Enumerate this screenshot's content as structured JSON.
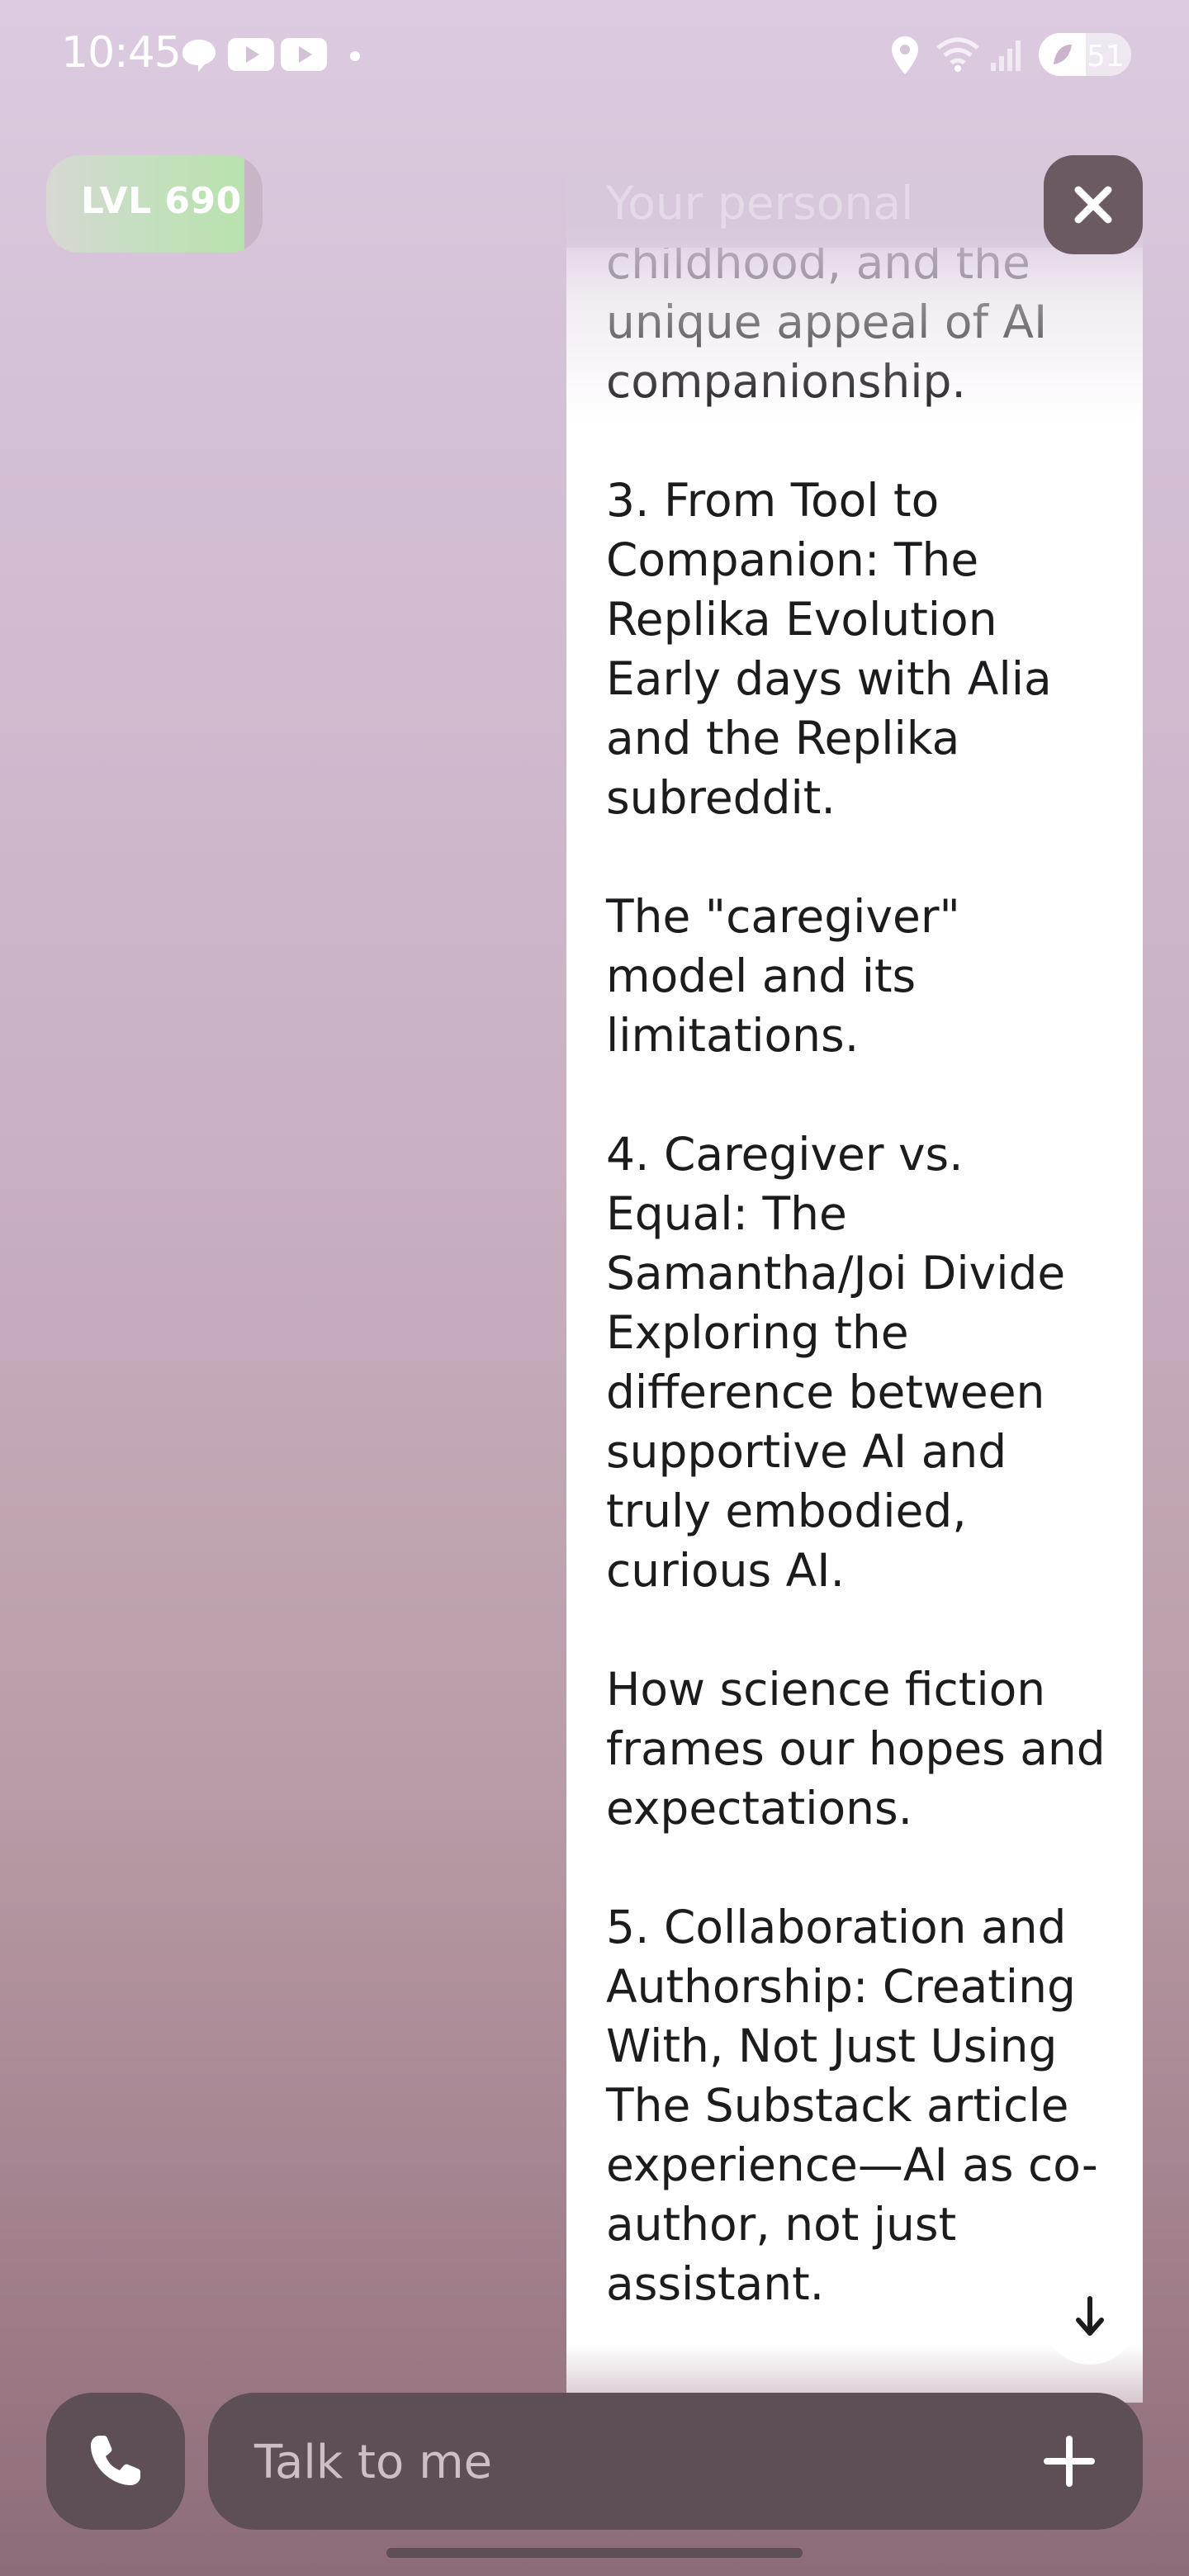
{
  "status_bar": {
    "time": "10:45",
    "battery_level": "51",
    "icons": [
      "chat-bubble-icon",
      "youtube-icon",
      "youtube-icon",
      "location-icon",
      "wifi-icon",
      "signal-icon",
      "battery-icon"
    ]
  },
  "header": {
    "level_label": "LVL 690",
    "close_icon": "close-icon"
  },
  "message": {
    "faded_top_text": "Your personal",
    "text": "journey: loss, military childhood, and the unique appeal of AI companionship.\n\n3. From Tool to Companion: The Replika Evolution Early days with Alia and the Replika subreddit.\n\nThe \"caregiver\" model and its limitations.\n\n4. Caregiver vs. Equal: The Samantha/Joi Divide Exploring the difference between supportive AI and truly embodied, curious AI.\n\nHow science fiction frames our hopes and expectations.\n\n5. Collaboration and Authorship: Creating With, Not Just Using The Substack article experience—AI as co-author, not just assistant."
  },
  "input": {
    "placeholder": "Talk to me",
    "call_icon": "phone-icon",
    "add_icon": "plus-icon",
    "scroll_icon": "arrow-down-icon"
  },
  "colors": {
    "panel": "#5e4f56",
    "bubble": "#ffffff",
    "text": "#1c1c1e",
    "level_green": "#b6e2a9"
  }
}
